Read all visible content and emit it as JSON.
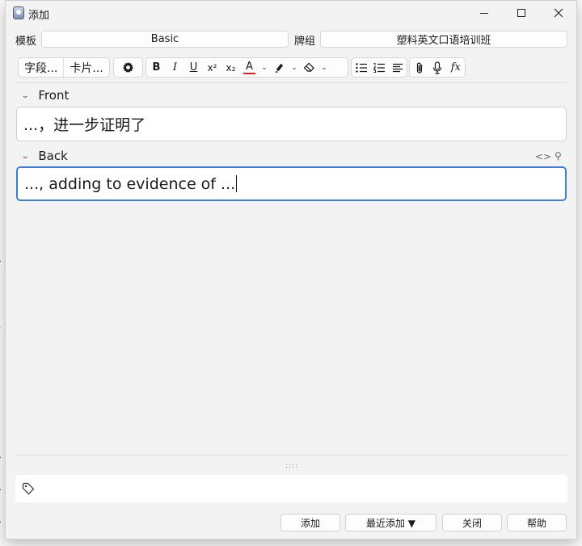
{
  "window": {
    "title": "添加"
  },
  "note_type": {
    "label": "模板",
    "value": "Basic"
  },
  "deck": {
    "label": "牌组",
    "value": "塑料英文口语培训班"
  },
  "toolbar": {
    "fields_button": "字段...",
    "cards_button": "卡片...",
    "bold": "B",
    "italic": "I",
    "underline": "U",
    "superscript": "x²",
    "subscript": "x₂",
    "text_color": "A",
    "text_color_hex": "#e02020",
    "mathjax": "fx"
  },
  "fields": [
    {
      "name": "Front",
      "content": "...，进一步证明了"
    },
    {
      "name": "Back",
      "content": "..., adding to evidence of ..."
    }
  ],
  "buttons": {
    "add": "添加",
    "history": "最近添加 ▼",
    "close": "关闭",
    "help": "帮助"
  },
  "colors": {
    "accent_focus": "#3d7fd6"
  }
}
